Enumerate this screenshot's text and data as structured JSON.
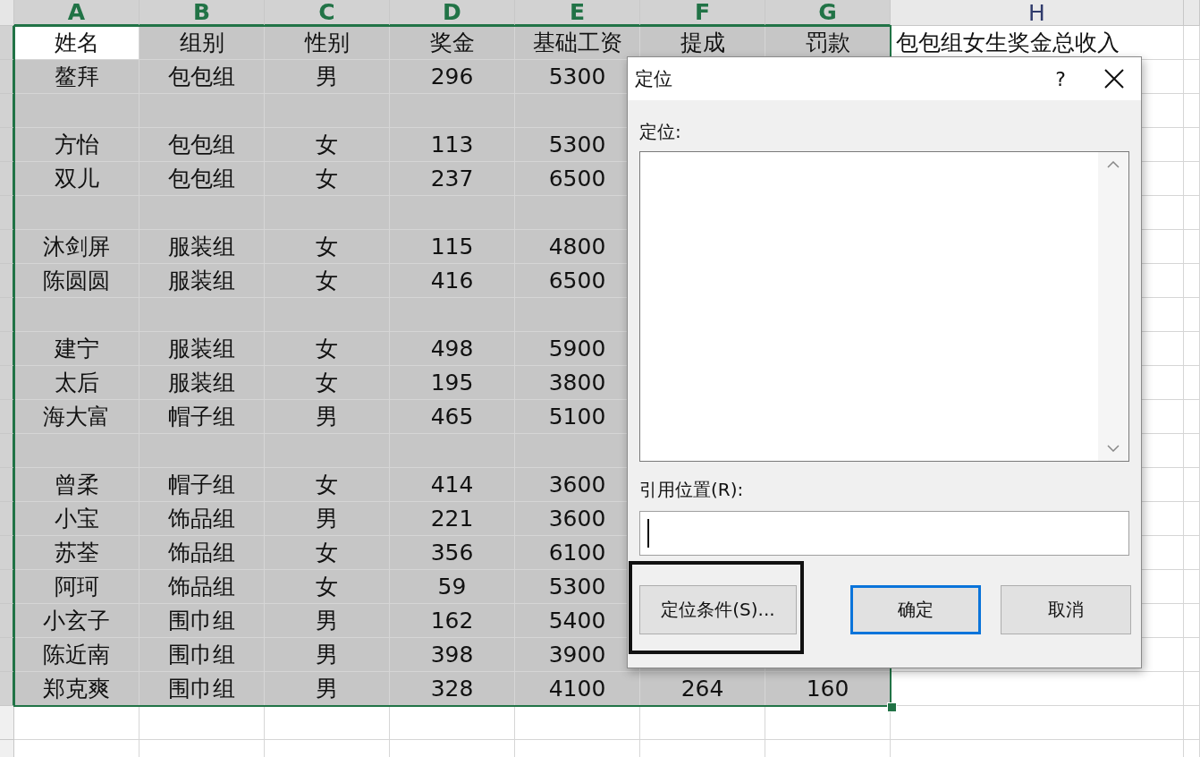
{
  "columns": [
    {
      "label": "A",
      "selected": true
    },
    {
      "label": "B",
      "selected": true
    },
    {
      "label": "C",
      "selected": true
    },
    {
      "label": "D",
      "selected": true
    },
    {
      "label": "E",
      "selected": true
    },
    {
      "label": "F",
      "selected": true
    },
    {
      "label": "G",
      "selected": true
    },
    {
      "label": "H",
      "selected": false
    }
  ],
  "rows": [
    {
      "selected": true,
      "active": true,
      "cells": [
        "姓名",
        "组别",
        "性别",
        "奖金",
        "基础工资",
        "提成",
        "罚款",
        "包包组女生奖金总收入"
      ]
    },
    {
      "selected": true,
      "active": false,
      "cells": [
        "鳌拜",
        "包包组",
        "男",
        "296",
        "5300",
        null,
        null,
        null
      ]
    },
    {
      "selected": true,
      "active": false,
      "cells": [
        null,
        null,
        null,
        null,
        null,
        null,
        null,
        null
      ]
    },
    {
      "selected": true,
      "active": false,
      "cells": [
        "方怡",
        "包包组",
        "女",
        "113",
        "5300",
        null,
        null,
        null
      ]
    },
    {
      "selected": true,
      "active": false,
      "cells": [
        "双儿",
        "包包组",
        "女",
        "237",
        "6500",
        null,
        null,
        null
      ]
    },
    {
      "selected": true,
      "active": false,
      "cells": [
        null,
        null,
        null,
        null,
        null,
        null,
        null,
        null
      ]
    },
    {
      "selected": true,
      "active": false,
      "cells": [
        "沐剑屏",
        "服装组",
        "女",
        "115",
        "4800",
        null,
        null,
        null
      ]
    },
    {
      "selected": true,
      "active": false,
      "cells": [
        "陈圆圆",
        "服装组",
        "女",
        "416",
        "6500",
        null,
        null,
        null
      ]
    },
    {
      "selected": true,
      "active": false,
      "cells": [
        null,
        null,
        null,
        null,
        null,
        null,
        null,
        null
      ]
    },
    {
      "selected": true,
      "active": false,
      "cells": [
        "建宁",
        "服装组",
        "女",
        "498",
        "5900",
        null,
        null,
        null
      ]
    },
    {
      "selected": true,
      "active": false,
      "cells": [
        "太后",
        "服装组",
        "女",
        "195",
        "3800",
        null,
        null,
        null
      ]
    },
    {
      "selected": true,
      "active": false,
      "cells": [
        "海大富",
        "帽子组",
        "男",
        "465",
        "5100",
        null,
        null,
        null
      ]
    },
    {
      "selected": true,
      "active": false,
      "cells": [
        null,
        null,
        null,
        null,
        null,
        null,
        null,
        null
      ]
    },
    {
      "selected": true,
      "active": false,
      "cells": [
        "曾柔",
        "帽子组",
        "女",
        "414",
        "3600",
        null,
        null,
        null
      ]
    },
    {
      "selected": true,
      "active": false,
      "cells": [
        "小宝",
        "饰品组",
        "男",
        "221",
        "3600",
        null,
        null,
        null
      ]
    },
    {
      "selected": true,
      "active": false,
      "cells": [
        "苏荃",
        "饰品组",
        "女",
        "356",
        "6100",
        null,
        null,
        null
      ]
    },
    {
      "selected": true,
      "active": false,
      "cells": [
        "阿珂",
        "饰品组",
        "女",
        "59",
        "5300",
        null,
        null,
        null
      ]
    },
    {
      "selected": true,
      "active": false,
      "cells": [
        "小玄子",
        "围巾组",
        "男",
        "162",
        "5400",
        null,
        null,
        null
      ]
    },
    {
      "selected": true,
      "active": false,
      "cells": [
        "陈近南",
        "围巾组",
        "男",
        "398",
        "3900",
        null,
        null,
        null
      ]
    },
    {
      "selected": true,
      "active": false,
      "cells": [
        "郑克爽",
        "围巾组",
        "男",
        "328",
        "4100",
        "264",
        "160",
        null
      ]
    },
    {
      "selected": false,
      "cells": [
        null,
        null,
        null,
        null,
        null,
        null,
        null,
        null
      ]
    },
    {
      "selected": false,
      "cells": [
        null,
        null,
        null,
        null,
        null,
        null,
        null,
        null
      ]
    }
  ],
  "dialog": {
    "title": "定位",
    "help": "?",
    "goto_label": "定位:",
    "reference_label": "引用位置(R):",
    "reference_focused": true,
    "buttons": [
      {
        "label": "定位条件(S)...",
        "default": false,
        "highlighted": true
      },
      {
        "label": "确定",
        "default": true,
        "highlighted": false
      },
      {
        "label": "取消",
        "default": false,
        "highlighted": false
      }
    ]
  }
}
